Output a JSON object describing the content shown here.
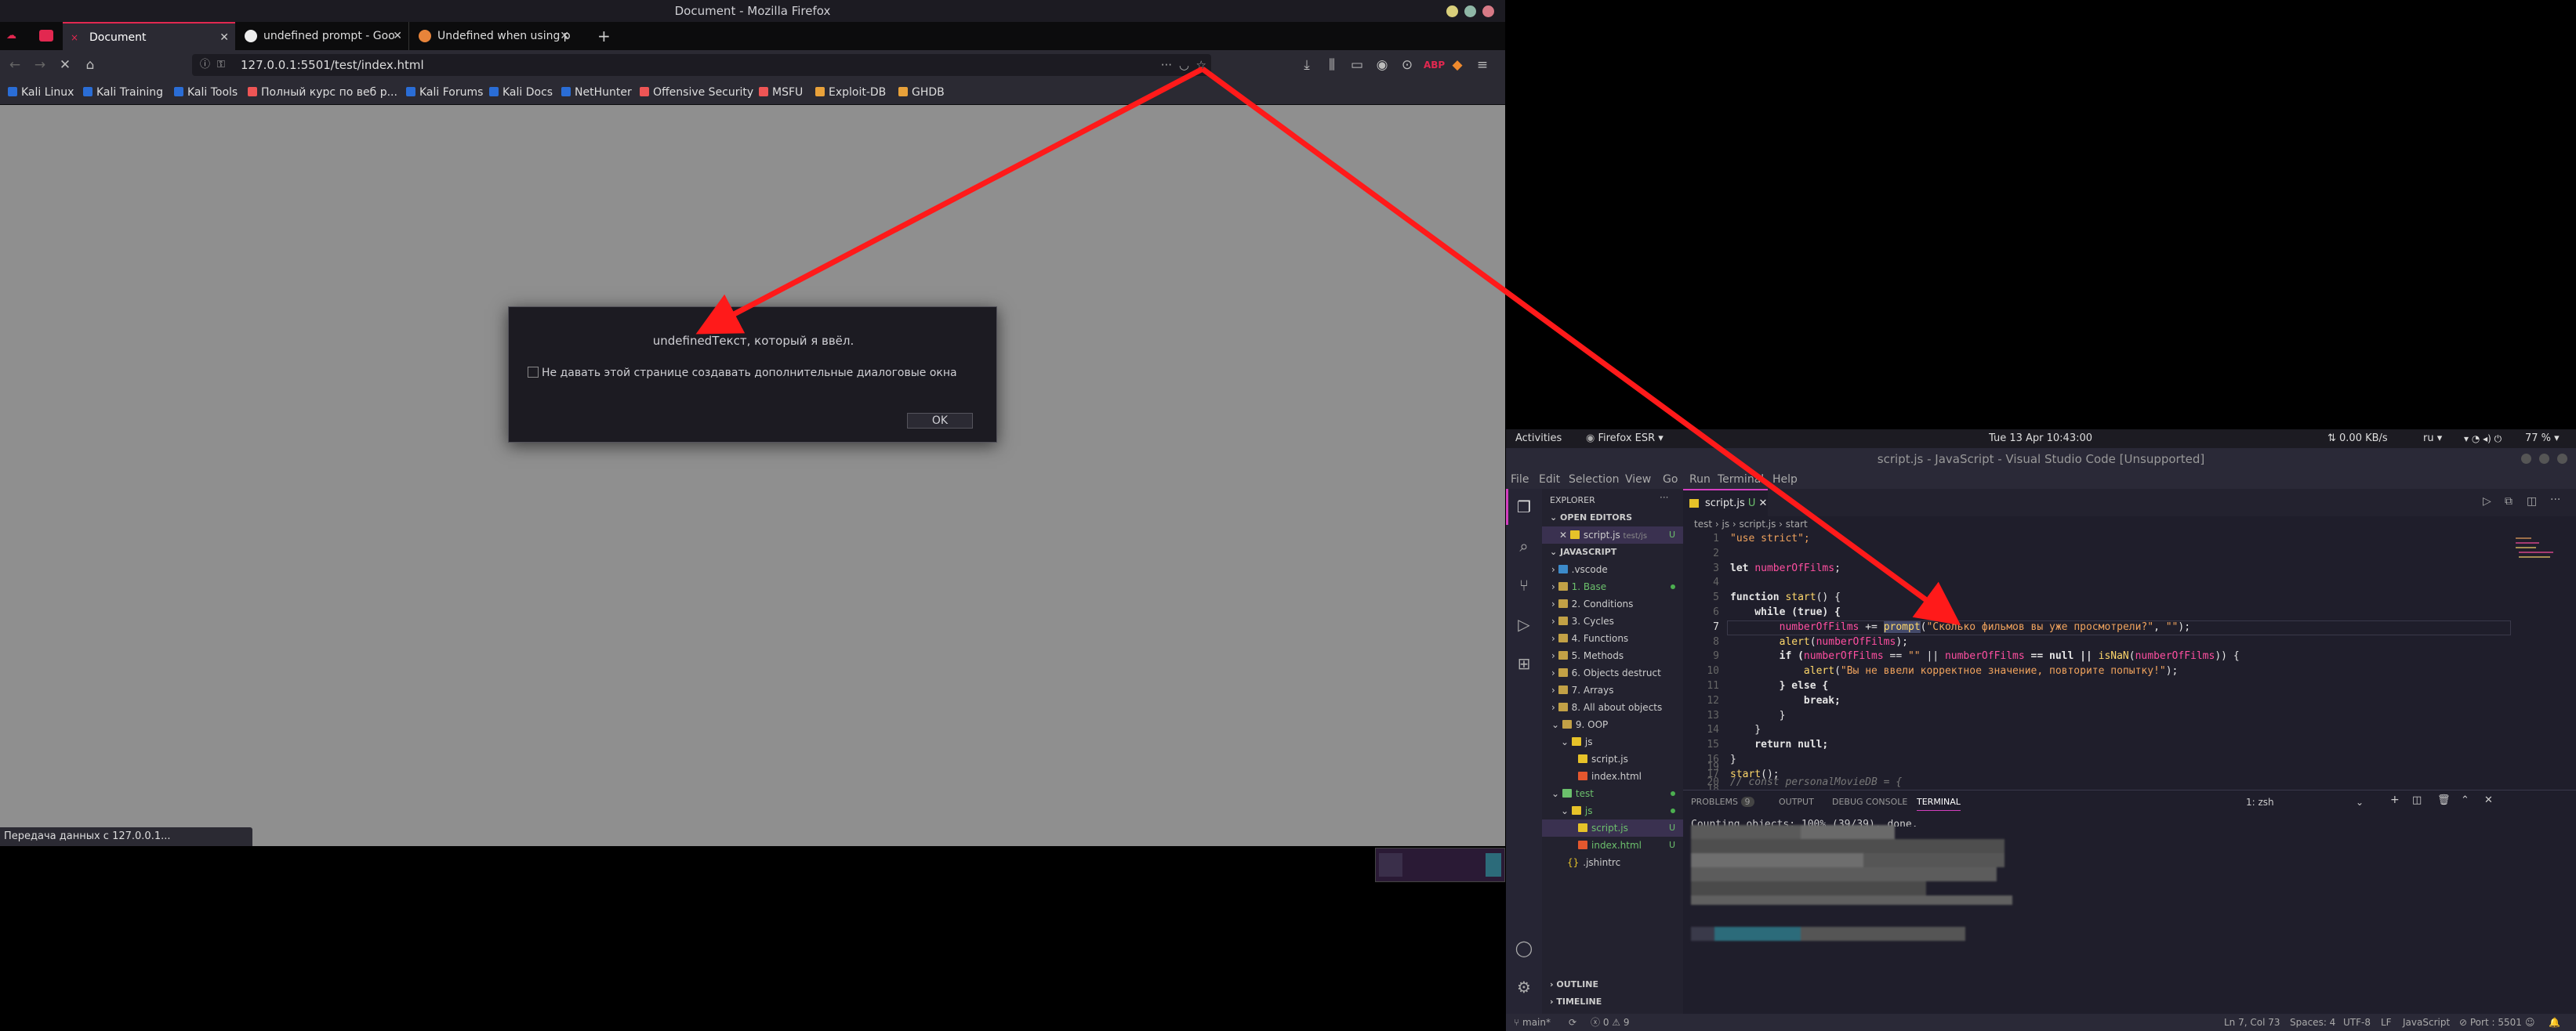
{
  "firefox": {
    "window_title": "Document - Mozilla Firefox",
    "tabs": [
      {
        "label": "Document"
      },
      {
        "label": "undefined prompt - Goo"
      },
      {
        "label": "Undefined when using p"
      }
    ],
    "url": "127.0.0.1:5501/test/index.html",
    "bookmarks": [
      "Kali Linux",
      "Kali Training",
      "Kali Tools",
      "Полный курс по веб р...",
      "Kali Forums",
      "Kali Docs",
      "NetHunter",
      "Offensive Security",
      "MSFU",
      "Exploit-DB",
      "GHDB"
    ],
    "dialog": {
      "message": "undefinedТекст, который я ввёл.",
      "checkbox_label": "Не давать этой странице создавать дополнительные диалоговые окна",
      "ok_label": "OK"
    },
    "status": "Передача данных с 127.0.0.1..."
  },
  "gnome": {
    "activities": "Activities",
    "app": "Firefox ESR",
    "clock": "Tue 13 Apr  10:43:00",
    "netspeed": "0.00 KB/s",
    "lang": "ru",
    "battery": "77 %"
  },
  "vscode": {
    "title": "script.js - JavaScript - Visual Studio Code [Unsupported]",
    "menu": [
      "File",
      "Edit",
      "Selection",
      "View",
      "Go",
      "Run",
      "Terminal",
      "Help"
    ],
    "explorer": {
      "header": "EXPLORER",
      "open_editors": "OPEN EDITORS",
      "open_file": "script.js",
      "open_file_path": "test/js",
      "workspace": "JAVASCRIPT",
      "tree": [
        ".vscode",
        "1. Base",
        "2. Conditions",
        "3. Cycles",
        "4. Functions",
        "5. Methods",
        "6. Objects destruct",
        "7. Arrays",
        "8. All about objects",
        "9. OOP",
        "js",
        "script.js",
        "index.html",
        "test",
        "js",
        "script.js",
        "index.html",
        ".jshintrc"
      ],
      "outline": "OUTLINE",
      "timeline": "TIMELINE"
    },
    "tab_label": "script.js",
    "tab_badge": "U",
    "breadcrumb": [
      "test",
      "js",
      "script.js",
      "start"
    ],
    "code_lines": [
      "1",
      "2",
      "3",
      "4",
      "5",
      "6",
      "7",
      "8",
      "9",
      "10",
      "11",
      "12",
      "13",
      "14",
      "15",
      "16",
      "17",
      "18",
      "19",
      "20"
    ],
    "code": {
      "l1": "\"use strict\";",
      "l3a": "let ",
      "l3b": "numberOfFilms",
      "l3c": ";",
      "l5a": "function ",
      "l5b": "start",
      "l5c": "() {",
      "l6": "    while (true) {",
      "l7a": "        ",
      "l7b": "numberOfFilms",
      "l7c": " += ",
      "l7d": "prompt",
      "l7e": "(",
      "l7f": "\"Сколько фильмов вы уже просмотрели?\"",
      "l7g": ", ",
      "l7h": "\"\"",
      "l7i": ");",
      "l8a": "        ",
      "l8b": "alert",
      "l8c": "(",
      "l8d": "numberOfFilms",
      "l8e": ");",
      "l9a": "        if (",
      "l9b": "numberOfFilms",
      "l9c": " == ",
      "l9d": "\"\"",
      "l9e": " || ",
      "l9f": "numberOfFilms",
      "l9g": " == null || ",
      "l9h": "isNaN",
      "l9i": "(",
      "l9j": "numberOfFilms",
      "l9k": ")) {",
      "l10a": "            ",
      "l10b": "alert",
      "l10c": "(",
      "l10d": "\"Вы не ввели корректное значение, повторите попытку!\"",
      "l10e": ");",
      "l11": "        } else {",
      "l12": "            break;",
      "l13": "        }",
      "l14": "    }",
      "l15": "    return null;",
      "l16": "}",
      "l17a": "start",
      "l17b": "();",
      "l20": "// const personalMovieDB = {"
    },
    "panel": {
      "problems": "PROBLEMS",
      "problems_count": "9",
      "output": "OUTPUT",
      "debug": "DEBUG CONSOLE",
      "terminal": "TERMINAL",
      "shell": "1: zsh",
      "term_line": "Counting objects: 100% (39/39), done."
    },
    "status": {
      "branch": "main*",
      "errors": "0",
      "warnings": "9",
      "position": "Ln 7, Col 73",
      "spaces": "Spaces: 4",
      "encoding": "UTF-8",
      "eol": "LF",
      "language": "JavaScript",
      "port": "Port : 5501"
    }
  },
  "colors": {
    "accent_firefox": "#e22850",
    "arrow": "#ff1a1a",
    "vscode_accent": "#d33fbf"
  }
}
